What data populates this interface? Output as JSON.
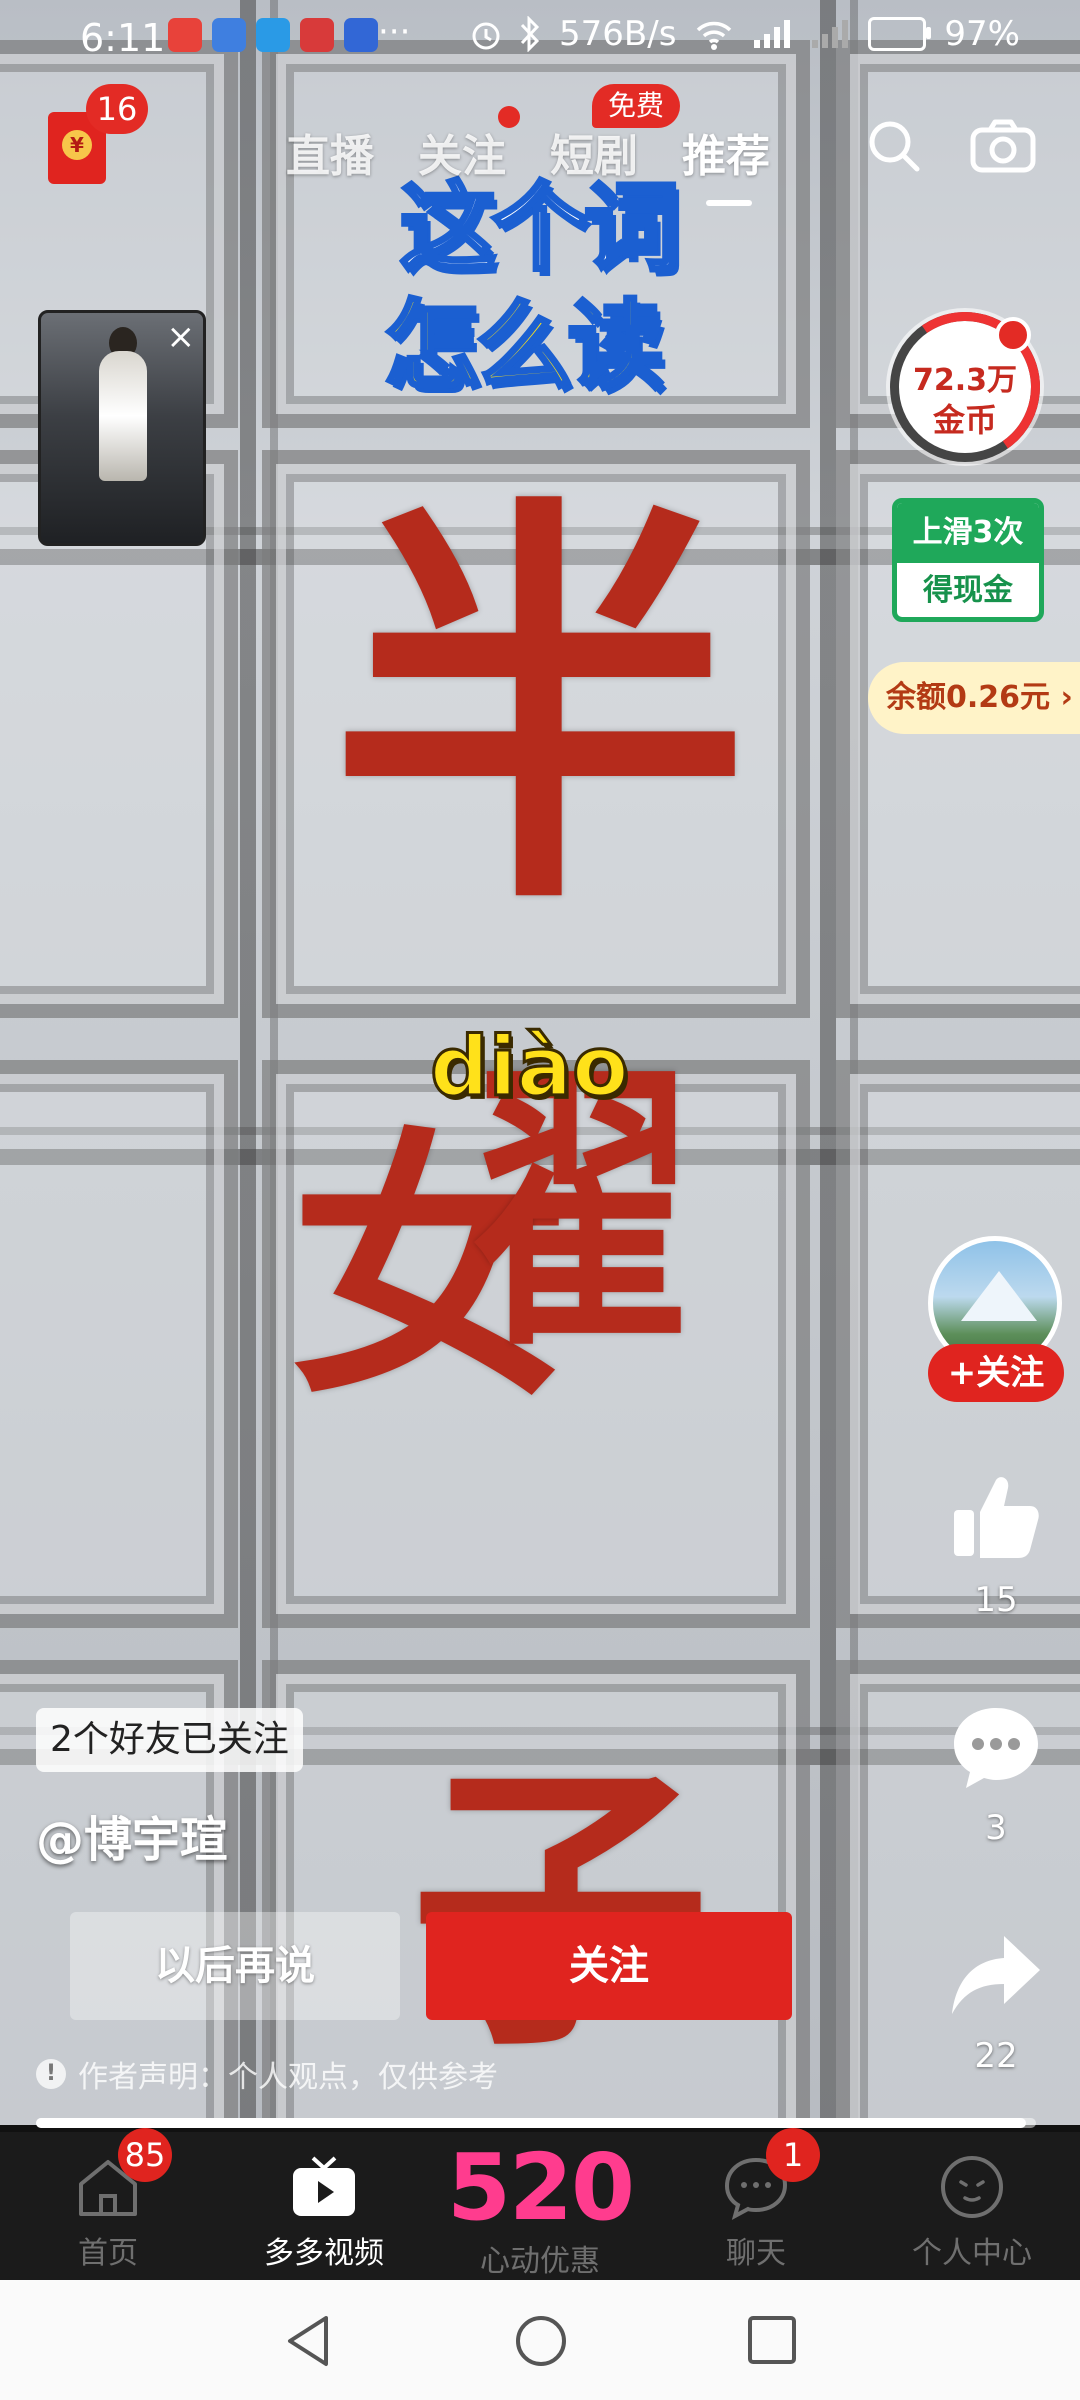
{
  "status_bar": {
    "time": "6:11",
    "overflow": "···",
    "network_speed": "576B/s",
    "battery": "97%"
  },
  "top_bar": {
    "red_packet_badge": "16",
    "tabs": [
      {
        "label": "直播",
        "active": false
      },
      {
        "label": "关注",
        "active": false,
        "dot": true
      },
      {
        "label": "短剧",
        "active": false
      },
      {
        "label": "推荐",
        "active": true
      }
    ],
    "free_badge": "免费",
    "search_icon": "search-icon",
    "camera_icon": "camera-icon"
  },
  "video": {
    "title_line1": "这个词",
    "title_line2": "怎么读",
    "char1": "半",
    "char2": "女",
    "char2b": "翟",
    "char3": "子",
    "pinyin": "diào"
  },
  "mini_player": {
    "close_icon": "close-icon"
  },
  "rewards": {
    "coins_value": "72.3万",
    "coins_unit": "金币",
    "swipe_task_line1": "上滑3次",
    "swipe_task_line2": "得现金",
    "balance": "余额0.26元"
  },
  "right_rail": {
    "follow_label": "+关注",
    "likes": "15",
    "comments": "3",
    "shares": "22"
  },
  "overlay": {
    "friends_followed": "2个好友已关注",
    "author": "@博宇瑄",
    "later_button": "以后再说",
    "follow_button": "关注",
    "statement": "作者声明：个人观点，仅供参考"
  },
  "progress": 0.99,
  "bottom_nav": {
    "items": [
      {
        "label": "首页",
        "badge": "85",
        "icon": "home-icon"
      },
      {
        "label": "多多视频",
        "icon": "video-icon",
        "active": true
      },
      {
        "label": "心动优惠",
        "big_text": "520"
      },
      {
        "label": "聊天",
        "badge": "1",
        "icon": "chat-icon"
      },
      {
        "label": "个人中心",
        "icon": "profile-icon"
      }
    ]
  },
  "colors": {
    "accent_red": "#e0241f",
    "pink_520": "#ff3c8e",
    "green_task": "#1fa85a",
    "brush_red": "#b52b1c",
    "pinyin_yellow": "#ffe11a"
  }
}
